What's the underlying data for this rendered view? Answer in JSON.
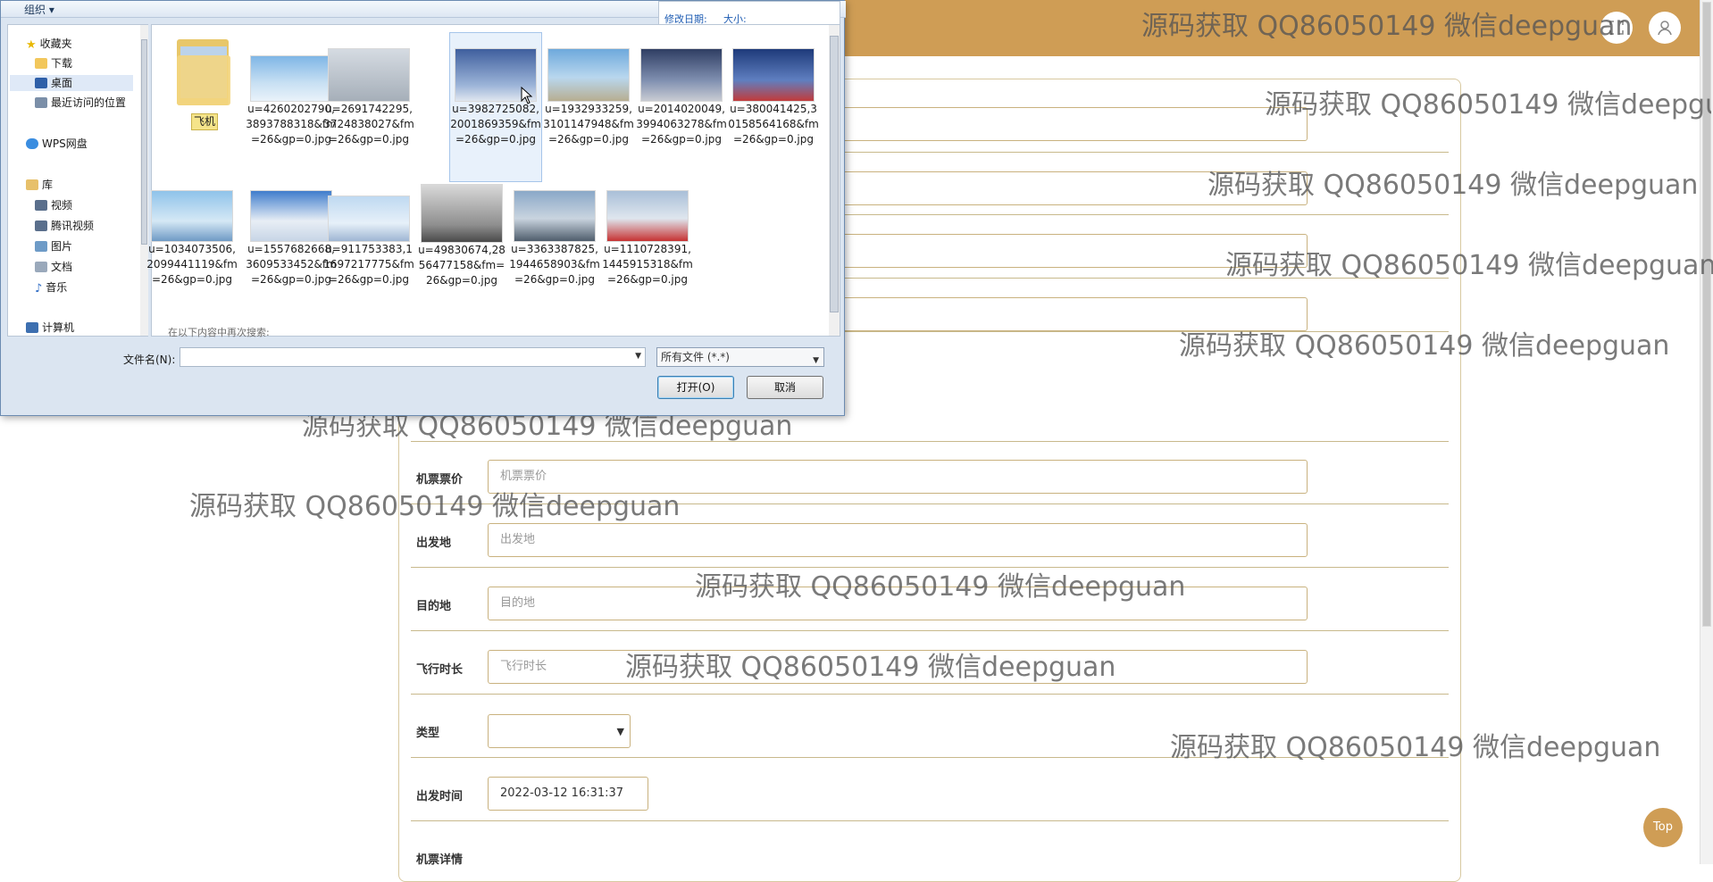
{
  "colors": {
    "accent": "#cf9d55",
    "field_border": "#c9b27f",
    "dialog_bg": "#dbe5f1",
    "link_blue": "#1e5cb3"
  },
  "header": {
    "fullscreen_icon": "expand-icon",
    "user_icon": "user-icon"
  },
  "form": {
    "fields": [
      {
        "label": "机票票价",
        "placeholder": "机票票价"
      },
      {
        "label": "出发地",
        "placeholder": "出发地"
      },
      {
        "label": "目的地",
        "placeholder": "目的地"
      },
      {
        "label": "飞行时长",
        "placeholder": "飞行时长"
      }
    ],
    "type_label": "类型",
    "type_value": "",
    "departure_label": "出发时间",
    "departure_value": "2022-03-12 16:31:37",
    "details_label": "机票详情"
  },
  "top_button": "Top",
  "watermark": "源码获取 QQ86050149 微信deepguan",
  "dialog": {
    "organize": "组织",
    "details": {
      "date_label": "修改日期:",
      "size_label": "大小:"
    },
    "nav": {
      "favorites": "收藏夹",
      "downloads": "下载",
      "desktop": "桌面",
      "recent": "最近访问的位置",
      "wps": "WPS网盘",
      "library": "库",
      "videos": "视频",
      "tencent_video": "腾讯视频",
      "pictures": "图片",
      "documents": "文档",
      "music": "音乐",
      "computer": "计算机"
    },
    "folder": {
      "name": "飞机"
    },
    "files": [
      "u=4260202790,3893788318&fm=26&gp=0.jpg",
      "u=2691742295,3724838027&fm=26&gp=0.jpg",
      "u=3982725082,2001869359&fm=26&gp=0.jpg",
      "u=1932933259,3101147948&fm=26&gp=0.jpg",
      "u=2014020049,3994063278&fm=26&gp=0.jpg",
      "u=380041425,30158564168&fm=26&gp=0.jpg",
      "u=1034073506,2099441119&fm=26&gp=0.jpg",
      "u=1557682668,3609533452&fm=26&gp=0.jpg",
      "u=911753383,11697217775&fm=26&gp=0.jpg",
      "u=49830674,2856477158&fm=26&gp=0.jpg",
      "u=3363387825,1944658903&fm=26&gp=0.jpg",
      "u=1110728391,1445915318&fm=26&gp=0.jpg"
    ],
    "search_again": "在以下内容中再次搜索:",
    "filename_label": "文件名(N):",
    "filename_value": "",
    "filetype": "所有文件 (*.*)",
    "open_button": "打开(O)",
    "cancel_button": "取消"
  }
}
